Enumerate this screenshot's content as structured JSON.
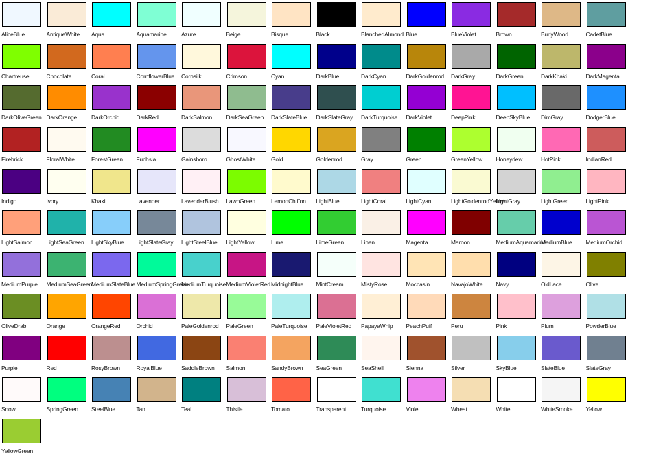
{
  "colors": [
    {
      "name": "AliceBlue",
      "hex": "#F0F8FF"
    },
    {
      "name": "AntiqueWhite",
      "hex": "#FAEBD7"
    },
    {
      "name": "Aqua",
      "hex": "#00FFFF"
    },
    {
      "name": "Aquamarine",
      "hex": "#7FFFD4"
    },
    {
      "name": "Azure",
      "hex": "#F0FFFF"
    },
    {
      "name": "Beige",
      "hex": "#F5F5DC"
    },
    {
      "name": "Bisque",
      "hex": "#FFE4C4"
    },
    {
      "name": "Black",
      "hex": "#000000"
    },
    {
      "name": "BlanchedAlmond",
      "hex": "#FFEBCD"
    },
    {
      "name": "Blue",
      "hex": "#0000FF"
    },
    {
      "name": "BlueViolet",
      "hex": "#8A2BE2"
    },
    {
      "name": "Brown",
      "hex": "#A52A2A"
    },
    {
      "name": "BurlyWood",
      "hex": "#DEB887"
    },
    {
      "name": "CadetBlue",
      "hex": "#5F9EA0"
    },
    {
      "name": "Chartreuse",
      "hex": "#7FFF00"
    },
    {
      "name": "Chocolate",
      "hex": "#D2691E"
    },
    {
      "name": "Coral",
      "hex": "#FF7F50"
    },
    {
      "name": "CornflowerBlue",
      "hex": "#6495ED"
    },
    {
      "name": "Cornsilk",
      "hex": "#FFF8DC"
    },
    {
      "name": "Crimson",
      "hex": "#DC143C"
    },
    {
      "name": "Cyan",
      "hex": "#00FFFF"
    },
    {
      "name": "DarkBlue",
      "hex": "#00008B"
    },
    {
      "name": "DarkCyan",
      "hex": "#008B8B"
    },
    {
      "name": "DarkGoldenrod",
      "hex": "#B8860B"
    },
    {
      "name": "DarkGray",
      "hex": "#A9A9A9"
    },
    {
      "name": "DarkGreen",
      "hex": "#006400"
    },
    {
      "name": "DarkKhaki",
      "hex": "#BDB76B"
    },
    {
      "name": "DarkMagenta",
      "hex": "#8B008B"
    },
    {
      "name": "DarkOliveGreen",
      "hex": "#556B2F"
    },
    {
      "name": "DarkOrange",
      "hex": "#FF8C00"
    },
    {
      "name": "DarkOrchid",
      "hex": "#9932CC"
    },
    {
      "name": "DarkRed",
      "hex": "#8B0000"
    },
    {
      "name": "DarkSalmon",
      "hex": "#E9967A"
    },
    {
      "name": "DarkSeaGreen",
      "hex": "#8FBC8F"
    },
    {
      "name": "DarkSlateBlue",
      "hex": "#483D8B"
    },
    {
      "name": "DarkSlateGray",
      "hex": "#2F4F4F"
    },
    {
      "name": "DarkTurquoise",
      "hex": "#00CED1"
    },
    {
      "name": "DarkViolet",
      "hex": "#9400D3"
    },
    {
      "name": "DeepPink",
      "hex": "#FF1493"
    },
    {
      "name": "DeepSkyBlue",
      "hex": "#00BFFF"
    },
    {
      "name": "DimGray",
      "hex": "#696969"
    },
    {
      "name": "DodgerBlue",
      "hex": "#1E90FF"
    },
    {
      "name": "Firebrick",
      "hex": "#B22222"
    },
    {
      "name": "FloralWhite",
      "hex": "#FFFAF0"
    },
    {
      "name": "ForestGreen",
      "hex": "#228B22"
    },
    {
      "name": "Fuchsia",
      "hex": "#FF00FF"
    },
    {
      "name": "Gainsboro",
      "hex": "#DCDCDC"
    },
    {
      "name": "GhostWhite",
      "hex": "#F8F8FF"
    },
    {
      "name": "Gold",
      "hex": "#FFD700"
    },
    {
      "name": "Goldenrod",
      "hex": "#DAA520"
    },
    {
      "name": "Gray",
      "hex": "#808080"
    },
    {
      "name": "Green",
      "hex": "#008000"
    },
    {
      "name": "GreenYellow",
      "hex": "#ADFF2F"
    },
    {
      "name": "Honeydew",
      "hex": "#F0FFF0"
    },
    {
      "name": "HotPink",
      "hex": "#FF69B4"
    },
    {
      "name": "IndianRed",
      "hex": "#CD5C5C"
    },
    {
      "name": "Indigo",
      "hex": "#4B0082"
    },
    {
      "name": "Ivory",
      "hex": "#FFFFF0"
    },
    {
      "name": "Khaki",
      "hex": "#F0E68C"
    },
    {
      "name": "Lavender",
      "hex": "#E6E6FA"
    },
    {
      "name": "LavenderBlush",
      "hex": "#FFF0F5"
    },
    {
      "name": "LawnGreen",
      "hex": "#7CFC00"
    },
    {
      "name": "LemonChiffon",
      "hex": "#FFFACD"
    },
    {
      "name": "LightBlue",
      "hex": "#ADD8E6"
    },
    {
      "name": "LightCoral",
      "hex": "#F08080"
    },
    {
      "name": "LightCyan",
      "hex": "#E0FFFF"
    },
    {
      "name": "LightGoldenrodYellow",
      "hex": "#FAFAD2"
    },
    {
      "name": "LightGray",
      "hex": "#D3D3D3"
    },
    {
      "name": "LightGreen",
      "hex": "#90EE90"
    },
    {
      "name": "LightPink",
      "hex": "#FFB6C1"
    },
    {
      "name": "LightSalmon",
      "hex": "#FFA07A"
    },
    {
      "name": "LightSeaGreen",
      "hex": "#20B2AA"
    },
    {
      "name": "LightSkyBlue",
      "hex": "#87CEFA"
    },
    {
      "name": "LightSlateGray",
      "hex": "#778899"
    },
    {
      "name": "LightSteelBlue",
      "hex": "#B0C4DE"
    },
    {
      "name": "LightYellow",
      "hex": "#FFFFE0"
    },
    {
      "name": "Lime",
      "hex": "#00FF00"
    },
    {
      "name": "LimeGreen",
      "hex": "#32CD32"
    },
    {
      "name": "Linen",
      "hex": "#FAF0E6"
    },
    {
      "name": "Magenta",
      "hex": "#FF00FF"
    },
    {
      "name": "Maroon",
      "hex": "#800000"
    },
    {
      "name": "MediumAquamarine",
      "hex": "#66CDAA"
    },
    {
      "name": "MediumBlue",
      "hex": "#0000CD"
    },
    {
      "name": "MediumOrchid",
      "hex": "#BA55D3"
    },
    {
      "name": "MediumPurple",
      "hex": "#9370DB"
    },
    {
      "name": "MediumSeaGreen",
      "hex": "#3CB371"
    },
    {
      "name": "MediumSlateBlue",
      "hex": "#7B68EE"
    },
    {
      "name": "MediumSpringGreen",
      "hex": "#00FA9A"
    },
    {
      "name": "MediumTurquoise",
      "hex": "#48D1CC"
    },
    {
      "name": "MediumVioletRed",
      "hex": "#C71585"
    },
    {
      "name": "MidnightBlue",
      "hex": "#191970"
    },
    {
      "name": "MintCream",
      "hex": "#F5FFFA"
    },
    {
      "name": "MistyRose",
      "hex": "#FFE4E1"
    },
    {
      "name": "Moccasin",
      "hex": "#FFE4B5"
    },
    {
      "name": "NavajoWhite",
      "hex": "#FFDEAD"
    },
    {
      "name": "Navy",
      "hex": "#000080"
    },
    {
      "name": "OldLace",
      "hex": "#FDF5E6"
    },
    {
      "name": "Olive",
      "hex": "#808000"
    },
    {
      "name": "OliveDrab",
      "hex": "#6B8E23"
    },
    {
      "name": "Orange",
      "hex": "#FFA500"
    },
    {
      "name": "OrangeRed",
      "hex": "#FF4500"
    },
    {
      "name": "Orchid",
      "hex": "#DA70D6"
    },
    {
      "name": "PaleGoldenrod",
      "hex": "#EEE8AA"
    },
    {
      "name": "PaleGreen",
      "hex": "#98FB98"
    },
    {
      "name": "PaleTurquoise",
      "hex": "#AFEEEE"
    },
    {
      "name": "PaleVioletRed",
      "hex": "#DB7093"
    },
    {
      "name": "PapayaWhip",
      "hex": "#FFEFD5"
    },
    {
      "name": "PeachPuff",
      "hex": "#FFDAB9"
    },
    {
      "name": "Peru",
      "hex": "#CD853F"
    },
    {
      "name": "Pink",
      "hex": "#FFC0CB"
    },
    {
      "name": "Plum",
      "hex": "#DDA0DD"
    },
    {
      "name": "PowderBlue",
      "hex": "#B0E0E6"
    },
    {
      "name": "Purple",
      "hex": "#800080"
    },
    {
      "name": "Red",
      "hex": "#FF0000"
    },
    {
      "name": "RosyBrown",
      "hex": "#BC8F8F"
    },
    {
      "name": "RoyalBlue",
      "hex": "#4169E1"
    },
    {
      "name": "SaddleBrown",
      "hex": "#8B4513"
    },
    {
      "name": "Salmon",
      "hex": "#FA8072"
    },
    {
      "name": "SandyBrown",
      "hex": "#F4A460"
    },
    {
      "name": "SeaGreen",
      "hex": "#2E8B57"
    },
    {
      "name": "SeaShell",
      "hex": "#FFF5EE"
    },
    {
      "name": "Sienna",
      "hex": "#A0522D"
    },
    {
      "name": "Silver",
      "hex": "#C0C0C0"
    },
    {
      "name": "SkyBlue",
      "hex": "#87CEEB"
    },
    {
      "name": "SlateBlue",
      "hex": "#6A5ACD"
    },
    {
      "name": "SlateGray",
      "hex": "#708090"
    },
    {
      "name": "Snow",
      "hex": "#FFFAFA"
    },
    {
      "name": "SpringGreen",
      "hex": "#00FF7F"
    },
    {
      "name": "SteelBlue",
      "hex": "#4682B4"
    },
    {
      "name": "Tan",
      "hex": "#D2B48C"
    },
    {
      "name": "Teal",
      "hex": "#008080"
    },
    {
      "name": "Thistle",
      "hex": "#D8BFD8"
    },
    {
      "name": "Tomato",
      "hex": "#FF6347"
    },
    {
      "name": "Transparent",
      "hex": "#FFFFFF"
    },
    {
      "name": "Turquoise",
      "hex": "#40E0D0"
    },
    {
      "name": "Violet",
      "hex": "#EE82EE"
    },
    {
      "name": "Wheat",
      "hex": "#F5DEB3"
    },
    {
      "name": "White",
      "hex": "#FFFFFF"
    },
    {
      "name": "WhiteSmoke",
      "hex": "#F5F5F5"
    },
    {
      "name": "Yellow",
      "hex": "#FFFF00"
    },
    {
      "name": "YellowGreen",
      "hex": "#9ACD32"
    }
  ]
}
